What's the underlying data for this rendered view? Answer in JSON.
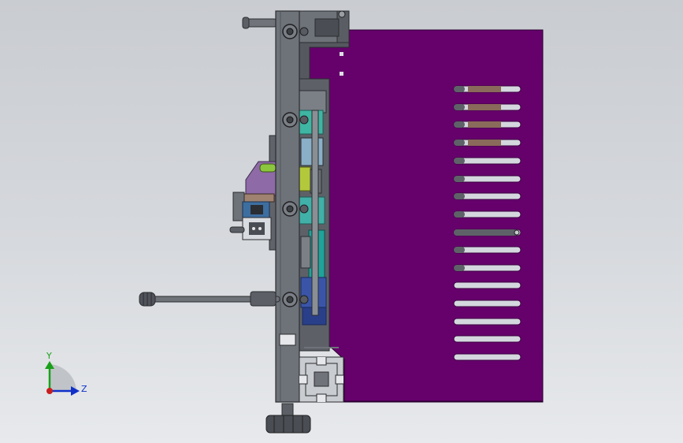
{
  "viewport": {
    "background_top": "#c9ccd1",
    "background_bottom": "#e7e9ec"
  },
  "colors": {
    "plate_purple": "#66006b",
    "steel": "#6e7279",
    "steel_dark": "#3c3f44",
    "slot": "#d4d8de",
    "teal": "#1fa39a",
    "tan": "#8a6a5a",
    "lime": "#8cc63f"
  },
  "triad": {
    "y_label": "Y",
    "z_label": "Z",
    "y_axis_color": "#19a019",
    "z_axis_color": "#1030c8",
    "origin_color": "#c81e1e"
  }
}
